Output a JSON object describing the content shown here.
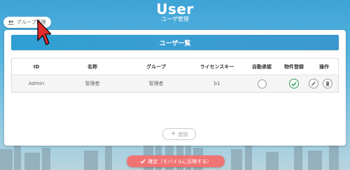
{
  "header": {
    "title": "User",
    "subtitle": "ユーザ管理"
  },
  "group_button": {
    "label": "グループ管理",
    "icon": "people-icon"
  },
  "card": {
    "title": "ユーザ一覧"
  },
  "table": {
    "columns": [
      "ID",
      "名称",
      "グループ",
      "ライセンスキー",
      "自動承認",
      "物件登録",
      "操作"
    ],
    "rows": [
      {
        "id": "Admin",
        "name": "管理者",
        "group": "管理者",
        "license": "b1",
        "auto_approve": false,
        "property_registration": true
      }
    ]
  },
  "add_button": {
    "label": "追加",
    "icon": "plus-icon"
  },
  "confirm_button": {
    "label": "確定（モバイルに反映する）",
    "icon": "check-icon"
  },
  "colors": {
    "accent": "#2f9fd3",
    "confirm": "#f07474",
    "check": "#2e9a5c"
  }
}
